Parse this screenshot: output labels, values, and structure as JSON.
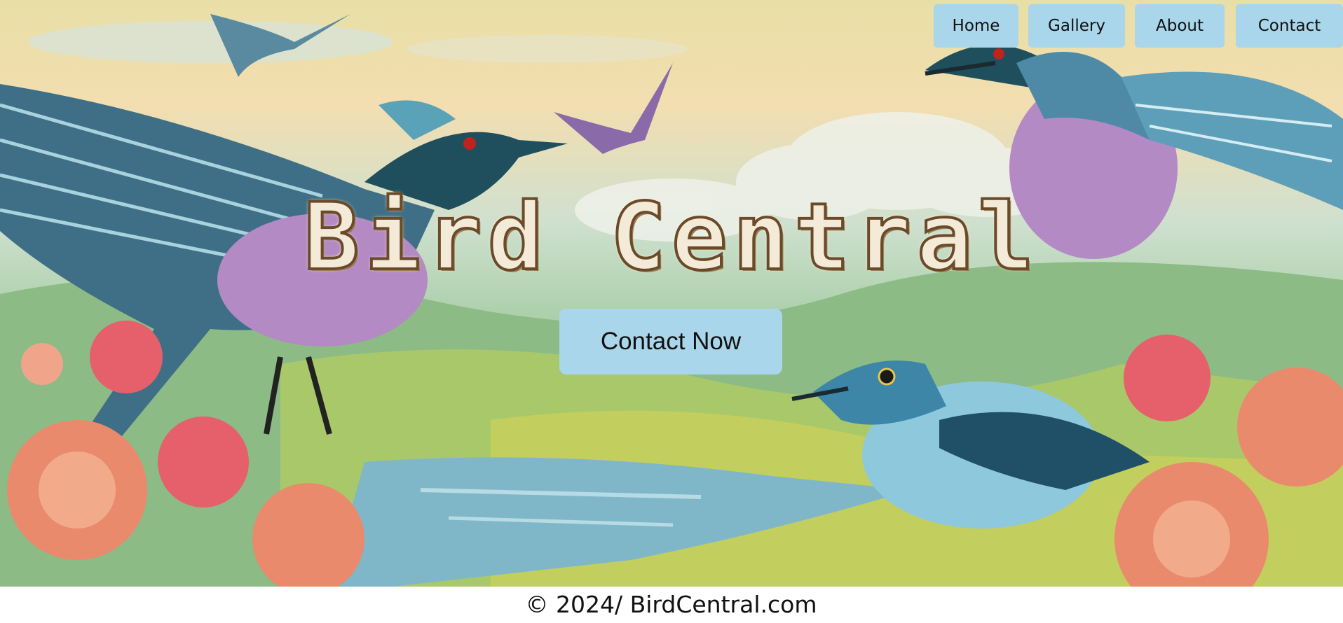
{
  "nav": {
    "items": [
      {
        "label": "Home"
      },
      {
        "label": "Gallery"
      },
      {
        "label": "About"
      },
      {
        "label": "Contact"
      }
    ]
  },
  "hero": {
    "title": "Bird Central",
    "cta_label": "Contact Now"
  },
  "footer": {
    "text": "© 2024/ BirdCentral.com"
  },
  "colors": {
    "button_bg": "#a9d6ea",
    "text": "#111111",
    "title_fill": "#f4ead8"
  },
  "icons": [
    "bird-illustration",
    "flower-illustration"
  ]
}
